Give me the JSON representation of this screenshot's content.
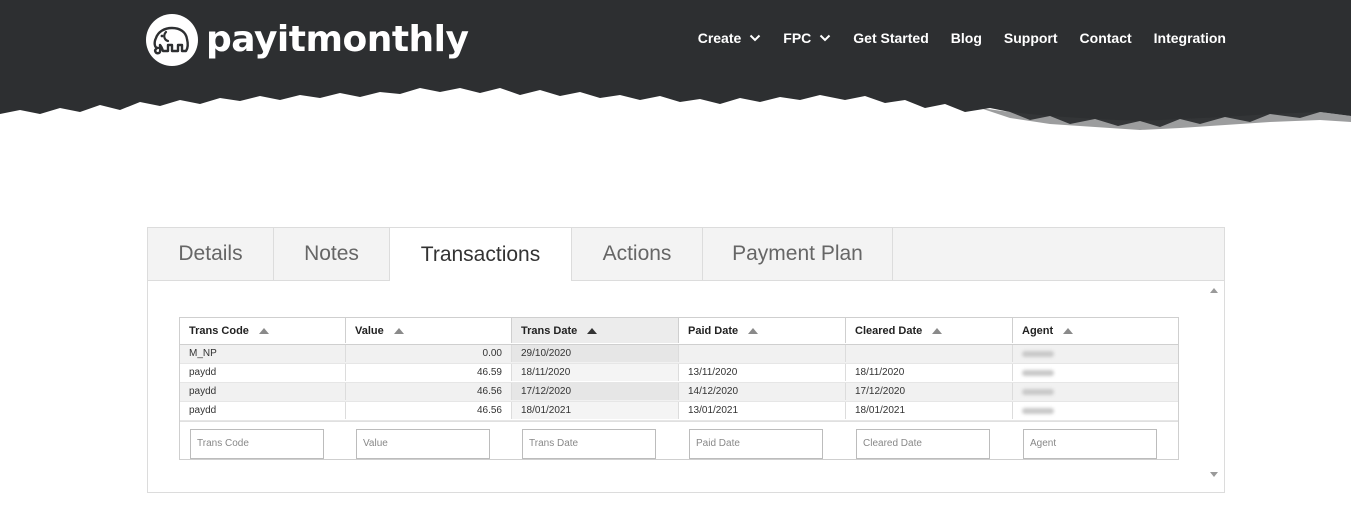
{
  "brand": {
    "name": "payitmonthly"
  },
  "nav": [
    {
      "label": "Create",
      "dropdown": true
    },
    {
      "label": "FPC",
      "dropdown": true
    },
    {
      "label": "Get Started",
      "dropdown": false
    },
    {
      "label": "Blog",
      "dropdown": false
    },
    {
      "label": "Support",
      "dropdown": false
    },
    {
      "label": "Contact",
      "dropdown": false
    },
    {
      "label": "Integration",
      "dropdown": false
    }
  ],
  "tabs": [
    {
      "label": "Details",
      "active": false
    },
    {
      "label": "Notes",
      "active": false
    },
    {
      "label": "Transactions",
      "active": true
    },
    {
      "label": "Actions",
      "active": false
    },
    {
      "label": "Payment Plan",
      "active": false
    }
  ],
  "grid": {
    "columns": [
      "Trans Code",
      "Value",
      "Trans Date",
      "Paid Date",
      "Cleared Date",
      "Agent"
    ],
    "sorted_column": "Trans Date",
    "rows": [
      [
        "M_NP",
        "0.00",
        "29/10/2020",
        "",
        "",
        ""
      ],
      [
        "paydd",
        "46.59",
        "18/11/2020",
        "13/11/2020",
        "18/11/2020",
        ""
      ],
      [
        "paydd",
        "46.56",
        "17/12/2020",
        "14/12/2020",
        "17/12/2020",
        ""
      ],
      [
        "paydd",
        "46.56",
        "18/01/2021",
        "13/01/2021",
        "18/01/2021",
        ""
      ]
    ],
    "filter_placeholders": [
      "Trans Code",
      "Value",
      "Trans Date",
      "Paid Date",
      "Cleared Date",
      "Agent"
    ]
  },
  "colors": {
    "header_bg": "#2d2f31",
    "tab_bg": "#f3f3f3",
    "border": "#dcdcdc"
  }
}
